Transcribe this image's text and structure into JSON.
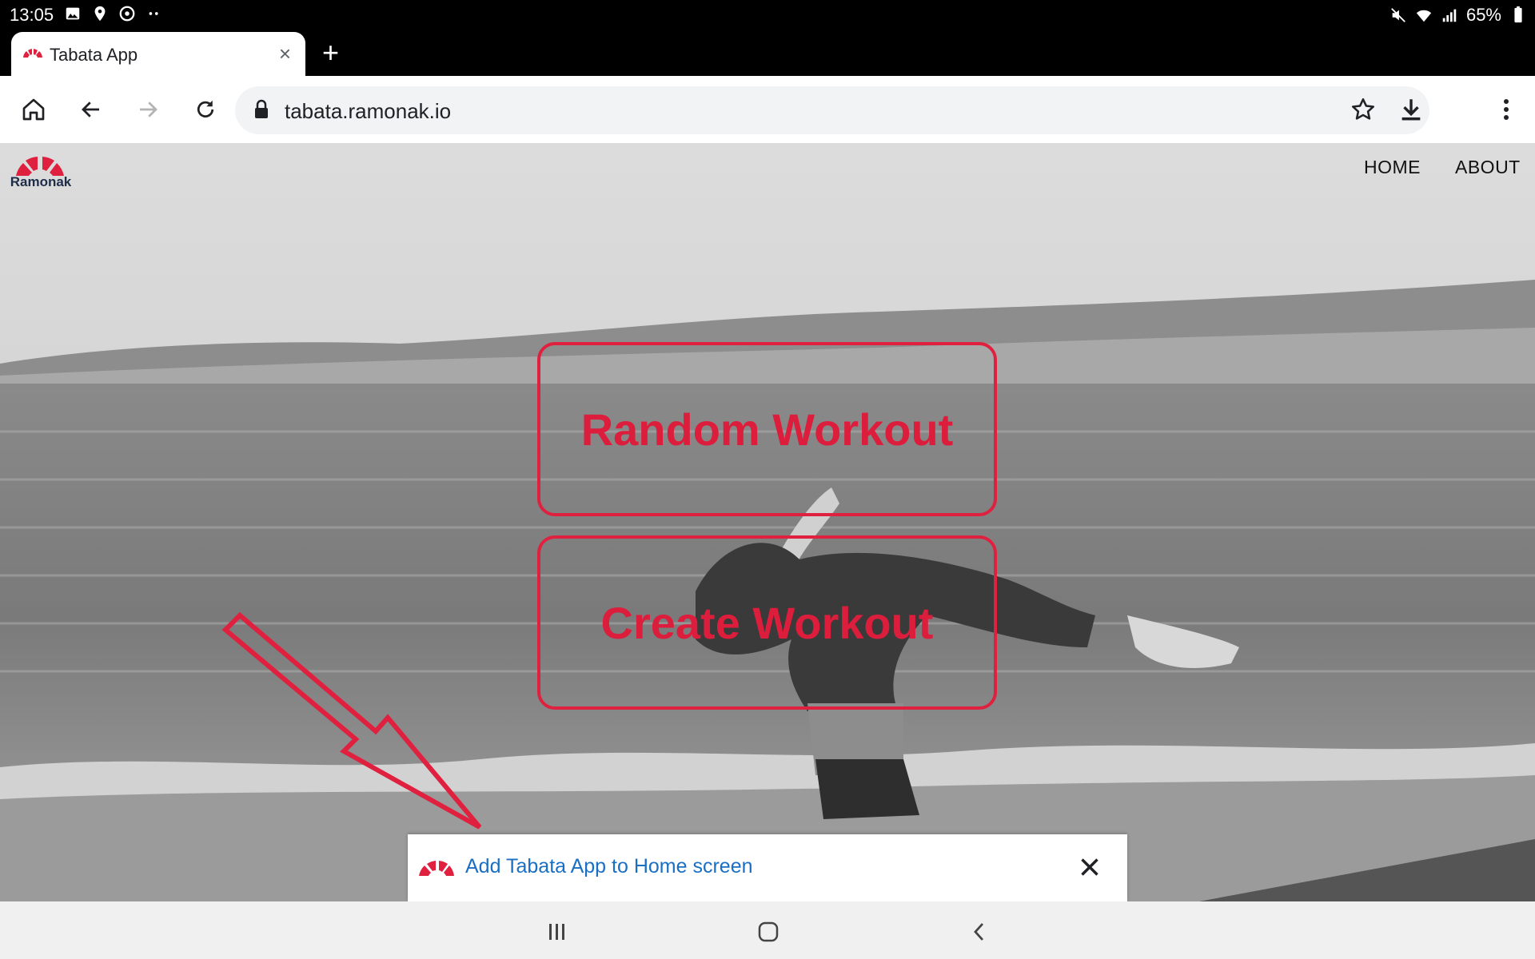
{
  "status_bar": {
    "time": "13:05",
    "left_icons": [
      "image-icon",
      "location-icon",
      "sync-icon",
      "more-dots-icon"
    ],
    "battery": "65%",
    "right_icons": [
      "mute-icon",
      "wifi-icon",
      "signal-icon",
      "battery-icon"
    ]
  },
  "browser": {
    "tab": {
      "title": "Tabata App",
      "close": "×"
    },
    "new_tab": "+",
    "url": "tabata.ramonak.io"
  },
  "site": {
    "logo_text": "Ramonak",
    "nav": {
      "home": "HOME",
      "about": "ABOUT"
    },
    "buttons": {
      "random": "Random Workout",
      "create": "Create Workout"
    }
  },
  "install_banner": {
    "text": "Add Tabata App to Home screen"
  },
  "colors": {
    "accent": "#e0203f",
    "link": "#1a6fc4",
    "logo_dark": "#1f2d4a"
  }
}
